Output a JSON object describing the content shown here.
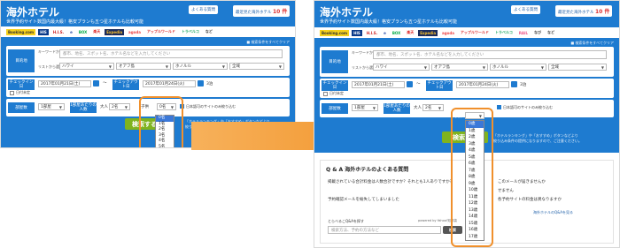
{
  "header": {
    "title": "海外ホテル",
    "subtitle": "世界予約サイト数国内最大級！格安プランも五つ星ホテルも比較可能",
    "faq_btn": "よくある質問",
    "history_btn": "最近見た海外ホテル",
    "history_count": "10 件"
  },
  "partners": [
    "Booking.com",
    "HIS",
    "H.I.S.",
    "e",
    "BOX",
    "楽天",
    "Expedia",
    "agoda",
    "アップルワールド",
    "トラベルコ",
    "RAIL",
    "なび",
    "など"
  ],
  "flag_text": "■ 検索条件をすべてクリア",
  "form": {
    "destination_label": "目的地",
    "keyword_label": "キーワードから選択",
    "keyword_placeholder": "都市、地名、スポット名、ホテル名などを入力してください",
    "list_label": "リストから選択",
    "region": "ハワイ",
    "island": "オアフ島",
    "city": "ホノルル",
    "area": "全域",
    "checkin_label": "チェックイン日",
    "checkin_value": "2017年01月21日(土)",
    "tilde": "〜",
    "checkout_label": "チェックアウト日",
    "checkout_value": "2017年01月24日(火)",
    "nights": "3泊",
    "undecided": "日付未定",
    "rooms_label": "部屋数",
    "rooms_value": "1部屋",
    "per_room_label": "1部屋あたりの人数",
    "adults_label": "大人",
    "adults_value": "2名",
    "children_label": "子供",
    "children_value": "0名",
    "domestic_check": "日本語可のサイトのみ絞り込む",
    "search_btn": "検索する",
    "note_line1": "「ホテルランキング」や「おすすめ」ボタンなどより",
    "note_line2": "絞り込み条件の提供になりますので、ご注意ください。"
  },
  "dropdown_left": [
    "0名",
    "1名",
    "2名",
    "3名",
    "4名",
    "5名",
    "6名"
  ],
  "dropdown_right": [
    "0歳",
    "1歳",
    "2歳",
    "3歳",
    "4歳",
    "5歳",
    "6歳",
    "7歳",
    "8歳",
    "9歳",
    "10歳",
    "11歳",
    "12歳",
    "13歳",
    "14歳",
    "15歳",
    "16歳",
    "17歳"
  ],
  "qa": {
    "title": "Q & A 海外ホテルのよくある質問",
    "items": [
      "掲載されている合計料金は人数合計ですか？それとも1人ありですか？",
      "予約確認メールを紛失してしまいました"
    ],
    "right1": "このメールが届きませんか",
    "right2": "せません",
    "right3": "各予約サイトの料金は異なりますか",
    "more": "海外ホテルのQ&Aを見る",
    "ask": "とらべるこQ&Aを探す",
    "ask_placeholder": "検索方法、予約の方法など",
    "powered": "powered by Yahoo!知恵袋",
    "ask_btn": "検索"
  },
  "colors": {
    "brand": "#1e7bd0",
    "search": "#7fb31e",
    "highlight": "#f0902c",
    "arrow": "#f08c1c"
  }
}
